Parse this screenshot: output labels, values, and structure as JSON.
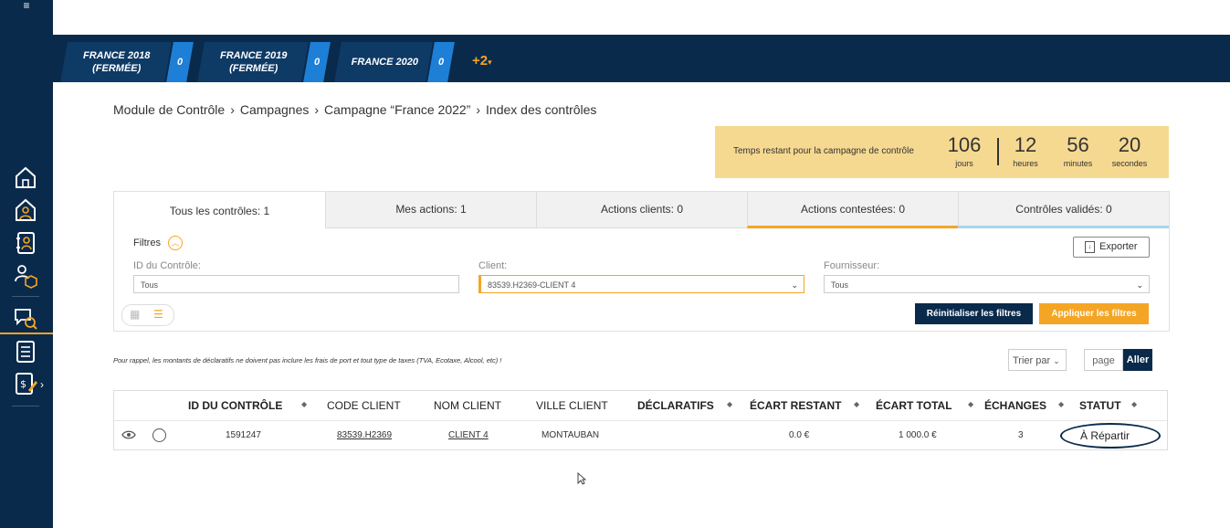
{
  "campaign_tabs": [
    {
      "name": "FRANCE 2018\n(FERMÉE)",
      "line1": "FRANCE 2018",
      "line2": "(FERMÉE)",
      "count": "0"
    },
    {
      "name": "FRANCE 2019",
      "line1": "FRANCE 2019",
      "line2": "(FERMÉE)",
      "count": "0"
    },
    {
      "name": "FRANCE 2020",
      "line1": "FRANCE 2020",
      "line2": "",
      "count": "0"
    }
  ],
  "more_campaigns": "+2",
  "breadcrumb": [
    "Module de Contrôle",
    "Campagnes",
    "Campagne “France 2022”",
    "Index des contrôles"
  ],
  "countdown": {
    "label": "Temps restant pour la campagne de contrôle",
    "days": "106",
    "days_label": "jours",
    "hours": "12",
    "hours_label": "heures",
    "minutes": "56",
    "minutes_label": "minutes",
    "seconds": "20",
    "seconds_label": "secondes"
  },
  "tabs": [
    "Tous les contrôles: 1",
    "Mes actions: 1",
    "Actions clients: 0",
    "Actions contestées: 0",
    "Contrôles validés: 0"
  ],
  "filters": {
    "title": "Filtres",
    "export_label": "Exporter",
    "id_label": "ID du Contrôle:",
    "id_placeholder": "Tous",
    "client_label": "Client:",
    "client_value": "83539.H2369-CLIENT 4",
    "supplier_label": "Fournisseur:",
    "supplier_value": "Tous",
    "reset_label": "Réinitialiser les filtres",
    "apply_label": "Appliquer les filtres"
  },
  "notice": "Pour rappel, les montants de déclaratifs ne doivent pas inclure les frais de port et tout type de taxes (TVA, Ecotaxe, Alcool, etc) !",
  "sort_label": "Trier par",
  "page_placeholder": "page",
  "go_label": "Aller",
  "table": {
    "headers": [
      "ID DU CONTRÔLE",
      "CODE CLIENT",
      "NOM CLIENT",
      "VILLE CLIENT",
      "DÉCLARATIFS",
      "ÉCART RESTANT",
      "ÉCART TOTAL",
      "ÉCHANGES",
      "STATUT"
    ],
    "rows": [
      {
        "id": "1591247",
        "code": "83539.H2369",
        "name": "CLIENT 4",
        "city": "MONTAUBAN",
        "declaratifs": "",
        "ecart_restant": "0.0 €",
        "ecart_total": "1 000.0 €",
        "echanges": "3",
        "statut": "À Répartir"
      }
    ]
  },
  "colors": {
    "navy": "#0a2a4b",
    "accent": "#f5a524",
    "count_blue": "#1d7fd6",
    "timer_bg": "#f6d991"
  },
  "icons": [
    "menu-icon",
    "home-icon",
    "user-icon",
    "contacts-icon",
    "user-box-icon",
    "search-chat-icon",
    "list-icon",
    "invoice-icon",
    "eye-icon",
    "export-icon",
    "grid-icon",
    "list-view-icon",
    "cursor-icon"
  ]
}
